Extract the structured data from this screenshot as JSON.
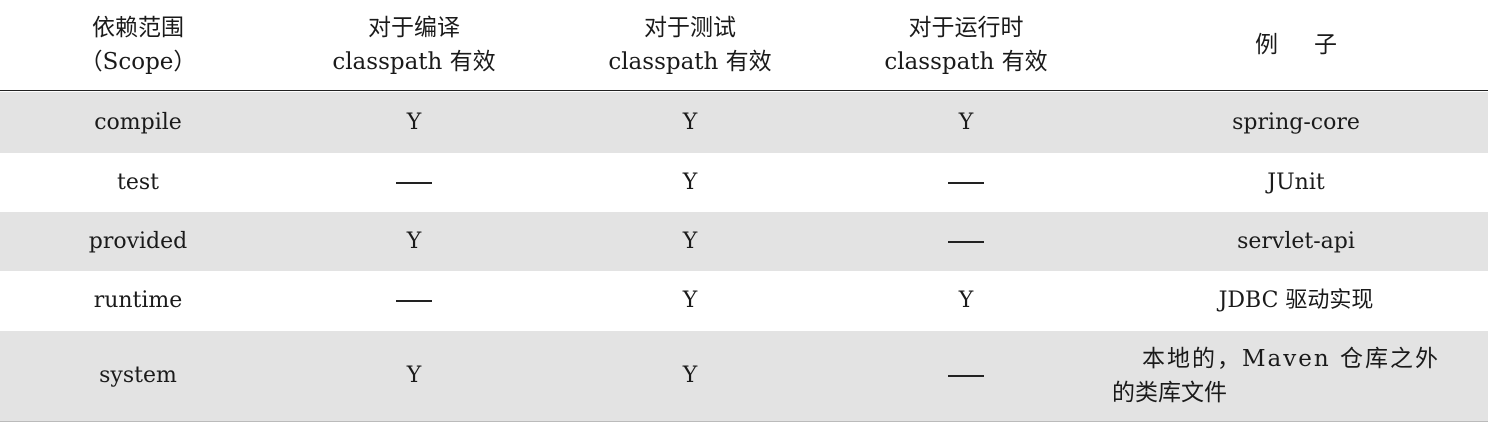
{
  "table": {
    "headers": [
      {
        "line1": "依赖范围",
        "line2": "（Scope）"
      },
      {
        "line1": "对于编译",
        "line2": "classpath 有效"
      },
      {
        "line1": "对于测试",
        "line2": "classpath 有效"
      },
      {
        "line1": "对于运行时",
        "line2": "classpath 有效"
      },
      {
        "line1": "例子",
        "line2": ""
      }
    ],
    "rows": [
      {
        "scope": "compile",
        "compile": "Y",
        "test": "Y",
        "runtime": "Y",
        "example": "spring-core",
        "example2": ""
      },
      {
        "scope": "test",
        "compile": "—",
        "test": "Y",
        "runtime": "—",
        "example": "JUnit",
        "example2": ""
      },
      {
        "scope": "provided",
        "compile": "Y",
        "test": "Y",
        "runtime": "—",
        "example": "servlet-api",
        "example2": ""
      },
      {
        "scope": "runtime",
        "compile": "—",
        "test": "Y",
        "runtime": "Y",
        "example": "JDBC 驱动实现",
        "example2": ""
      },
      {
        "scope": "system",
        "compile": "Y",
        "test": "Y",
        "runtime": "—",
        "example": "本地的，Maven 仓库之外",
        "example2": "的类库文件"
      }
    ]
  },
  "colors": {
    "shaded_row": "#e3e3e3",
    "rule": "#222222"
  }
}
